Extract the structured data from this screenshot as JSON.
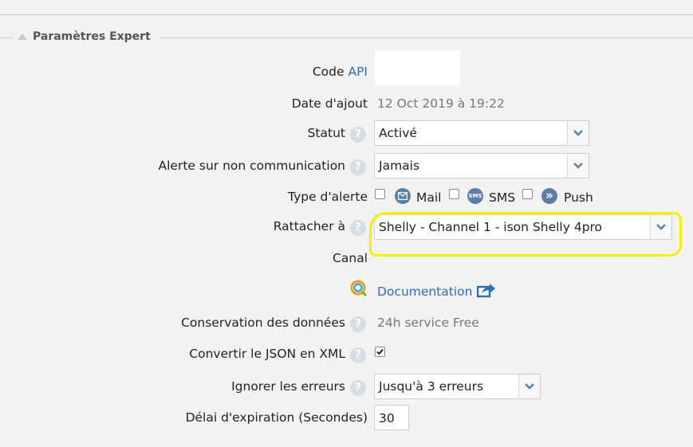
{
  "section": {
    "title": "Paramètres Expert"
  },
  "fields": {
    "api_code": {
      "label_prefix": "Code",
      "label_link": "API",
      "value": ""
    },
    "date_added": {
      "label": "Date d'ajout",
      "value": "12 Oct 2019 à 19:22"
    },
    "status": {
      "label": "Statut",
      "value": "Activé"
    },
    "alert_no_comm": {
      "label": "Alerte sur non communication",
      "value": "Jamais"
    },
    "alert_type": {
      "label": "Type d'alerte",
      "options": [
        {
          "icon": "mail-icon",
          "label": "Mail",
          "icon_text": ""
        },
        {
          "icon": "sms-icon",
          "label": "SMS",
          "icon_text": "SMS"
        },
        {
          "icon": "push-icon",
          "label": "Push",
          "icon_text": "»"
        }
      ]
    },
    "attach_to": {
      "label": "Rattacher à",
      "value": "Shelly - Channel 1 - ison Shelly 4pro"
    },
    "channel": {
      "label": "Canal",
      "value": ""
    },
    "documentation": {
      "label": "Documentation"
    },
    "data_retention": {
      "label": "Conservation des données",
      "value": "24h service Free"
    },
    "json_to_xml": {
      "label": "Convertir le JSON en XML",
      "checked": true
    },
    "ignore_errors": {
      "label": "Ignorer les erreurs",
      "value": "Jusqu'à 3 erreurs"
    },
    "timeout": {
      "label": "Délai d'expiration (Secondes)",
      "value": "30"
    }
  },
  "help_icon_text": "?",
  "colors": {
    "link": "#2e6db4",
    "highlight": "#f5f000",
    "icon_blue": "#5b7fa6"
  }
}
